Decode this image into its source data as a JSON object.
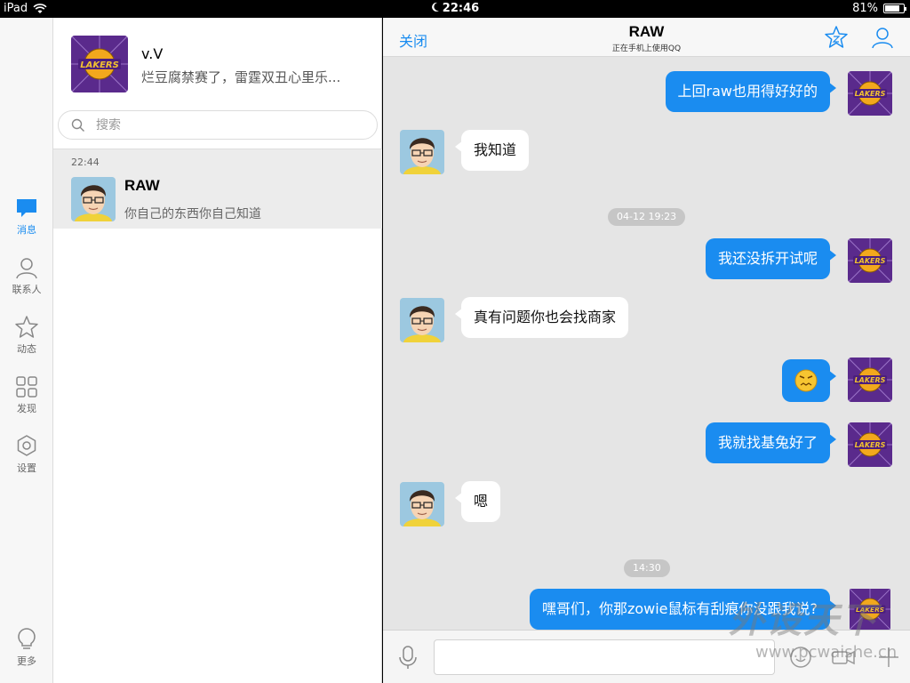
{
  "status_bar": {
    "device": "iPad",
    "time": "22:46",
    "battery": "81%",
    "battery_level": 0.81,
    "icons": [
      "wifi-icon",
      "moon-icon",
      "battery-icon"
    ]
  },
  "rail": {
    "items": [
      {
        "label": "消息",
        "icon": "message-bubble-icon",
        "active": true
      },
      {
        "label": "联系人",
        "icon": "person-icon",
        "active": false
      },
      {
        "label": "动态",
        "icon": "star-icon",
        "active": false
      },
      {
        "label": "发现",
        "icon": "grid-icon",
        "active": false
      },
      {
        "label": "设置",
        "icon": "gear-icon",
        "active": false
      }
    ],
    "more": {
      "label": "更多",
      "icon": "lightbulb-icon"
    }
  },
  "profile": {
    "name": "v.V",
    "status": "烂豆腐禁赛了，雷霆双丑心里乐...",
    "avatar": "lakers-avatar"
  },
  "search": {
    "placeholder": "搜索",
    "icon": "search-icon"
  },
  "conversations": [
    {
      "time": "22:44",
      "name": "RAW",
      "last_message": "你自己的东西你自己知道",
      "avatar": "cartoon-glasses-avatar"
    }
  ],
  "chat": {
    "close_label": "关闭",
    "title": "RAW",
    "subtitle": "正在手机上使用QQ",
    "header_icons": [
      "star-chat-icon",
      "profile-icon"
    ],
    "messages": [
      {
        "dir": "out",
        "text": "上回raw也用得好好的"
      },
      {
        "dir": "in",
        "text": "我知道"
      },
      {
        "type": "time",
        "text": "04-12 19:23"
      },
      {
        "dir": "out",
        "text": "我还没拆开试呢"
      },
      {
        "dir": "in",
        "text": "真有问题你也会找商家"
      },
      {
        "dir": "out",
        "emoji": "grumpy-face-emoji"
      },
      {
        "dir": "out",
        "text": "我就找基兔好了"
      },
      {
        "dir": "in",
        "text": "嗯"
      },
      {
        "type": "time",
        "text": "14:30"
      },
      {
        "dir": "out",
        "text": "嘿哥们，你那zowie鼠标有刮痕你没跟我说?"
      }
    ]
  },
  "input_bar": {
    "icons": [
      "microphone-icon",
      "emoji-icon",
      "video-icon",
      "plus-icon"
    ],
    "value": ""
  },
  "watermark": {
    "brand": "外设天下",
    "url": "www.pcwaishe.cn"
  },
  "colors": {
    "accent": "#1a8cf0",
    "chat_bg": "#e5e5e5",
    "bubble_in": "#ffffff"
  }
}
